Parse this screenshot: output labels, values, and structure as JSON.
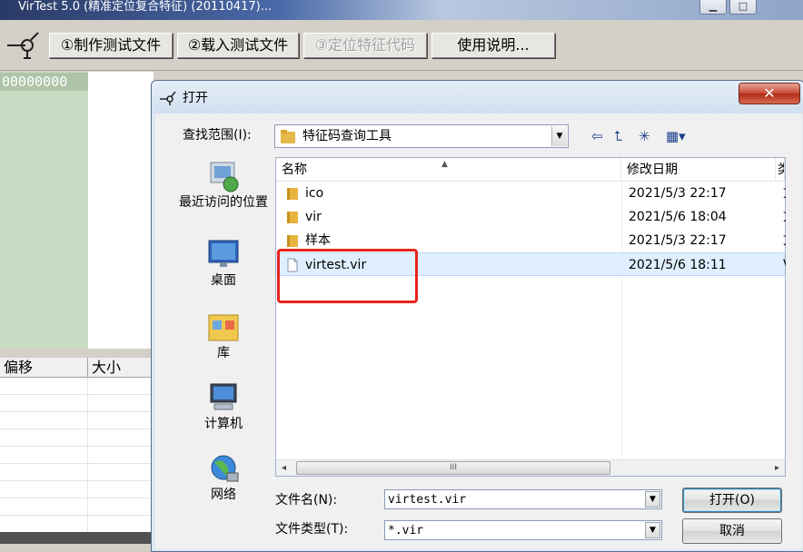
{
  "app": {
    "title": "VirTest 5.0 (精准定位复合特征) (20110417)...",
    "toolbar": {
      "make_test_file": "①制作测试文件",
      "load_test_file": "②载入测试文件",
      "locate_signature": "③定位特征代码",
      "instructions": "使用说明..."
    },
    "hex_value": "00000000",
    "list_columns": [
      "偏移",
      "大小"
    ]
  },
  "dialog": {
    "title": "打开",
    "look_in_label": "查找范围(I):",
    "look_in_value": "特征码查询工具",
    "places": [
      {
        "label": "最近访问的位置",
        "icon": "recent-places-icon"
      },
      {
        "label": "桌面",
        "icon": "desktop-icon"
      },
      {
        "label": "库",
        "icon": "libraries-icon"
      },
      {
        "label": "计算机",
        "icon": "computer-icon"
      },
      {
        "label": "网络",
        "icon": "network-icon"
      }
    ],
    "columns": {
      "name": "名称",
      "modified": "修改日期",
      "extra": "类"
    },
    "files": [
      {
        "name": "ico",
        "modified": "2021/5/3 22:17",
        "extra": "文",
        "type": "folder",
        "selected": false
      },
      {
        "name": "vir",
        "modified": "2021/5/6 18:04",
        "extra": "文",
        "type": "folder",
        "selected": false
      },
      {
        "name": "样本",
        "modified": "2021/5/3 22:17",
        "extra": "文",
        "type": "folder",
        "selected": false
      },
      {
        "name": "virtest.vir",
        "modified": "2021/5/6 18:11",
        "extra": "V",
        "type": "file",
        "selected": true
      }
    ],
    "scroll_grip": "III",
    "filename_label": "文件名(N):",
    "filename_value": "virtest.vir",
    "filetype_label": "文件类型(T):",
    "filetype_value": "*.vir",
    "open_button": "打开(O)",
    "cancel_button": "取消"
  },
  "colors": {
    "highlight_box": "#e8231f",
    "selected_row": "#e0efff",
    "close_button": "#c74a34"
  }
}
